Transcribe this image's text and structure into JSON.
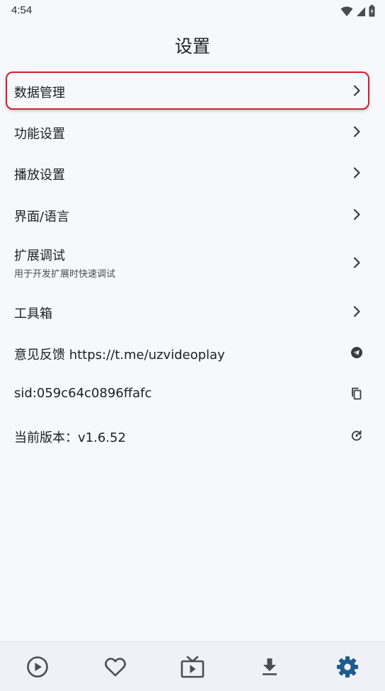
{
  "status_bar": {
    "time": "4:54",
    "icons": [
      "wifi-icon",
      "signal-icon",
      "battery-charging-icon"
    ]
  },
  "header": {
    "title": "设置"
  },
  "settings": {
    "items": [
      {
        "label": "数据管理",
        "icon": "chevron-right-icon"
      },
      {
        "label": "功能设置",
        "icon": "chevron-right-icon"
      },
      {
        "label": "播放设置",
        "icon": "chevron-right-icon"
      },
      {
        "label": "界面/语言",
        "icon": "chevron-right-icon"
      },
      {
        "label": "扩展调试",
        "subtitle": "用于开发扩展时快速调试",
        "icon": "chevron-right-icon"
      },
      {
        "label": "工具箱",
        "icon": "chevron-right-icon"
      },
      {
        "label": "意见反馈 https://t.me/uzvideoplay",
        "icon": "telegram-icon"
      },
      {
        "label": "sid:059c64c0896ffafc",
        "icon": "copy-icon"
      },
      {
        "label": "当前版本：v1.6.52",
        "icon": "refresh-icon"
      }
    ]
  },
  "bottom_nav": {
    "items": [
      {
        "icon": "play-circle-icon",
        "active": false
      },
      {
        "icon": "heart-icon",
        "active": false
      },
      {
        "icon": "tv-play-icon",
        "active": false
      },
      {
        "icon": "download-icon",
        "active": false
      },
      {
        "icon": "gear-icon",
        "active": true
      }
    ],
    "colors": {
      "inactive": "#4a4d55",
      "active": "#1f5c8e"
    }
  },
  "colors": {
    "background": "#f7f8fc",
    "highlight_border": "#d21f2a"
  }
}
